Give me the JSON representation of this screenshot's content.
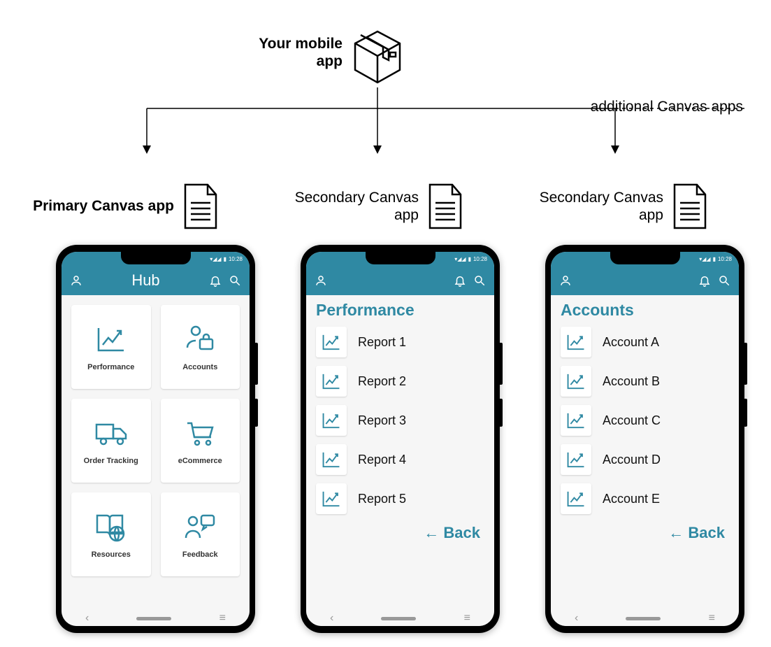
{
  "top": {
    "package_label": "Your mobile app",
    "additional_label": "additional Canvas apps"
  },
  "docs": [
    {
      "label": "Primary Canvas app",
      "primary": true
    },
    {
      "label": "Secondary Canvas app",
      "primary": false
    },
    {
      "label": "Secondary Canvas app",
      "primary": false
    }
  ],
  "status": {
    "time": "10:28"
  },
  "phone1": {
    "header_title": "Hub",
    "tiles": [
      {
        "label": "Performance",
        "icon": "chart"
      },
      {
        "label": "Accounts",
        "icon": "user-briefcase"
      },
      {
        "label": "Order Tracking",
        "icon": "truck"
      },
      {
        "label": "eCommerce",
        "icon": "cart"
      },
      {
        "label": "Resources",
        "icon": "book-globe"
      },
      {
        "label": "Feedback",
        "icon": "user-chat"
      }
    ]
  },
  "phone2": {
    "section_title": "Performance",
    "items": [
      "Report 1",
      "Report 2",
      "Report 3",
      "Report 4",
      "Report 5"
    ],
    "back_label": "← Back"
  },
  "phone3": {
    "section_title": "Accounts",
    "items": [
      "Account A",
      "Account B",
      "Account C",
      "Account D",
      "Account E"
    ],
    "back_label": "← Back"
  }
}
